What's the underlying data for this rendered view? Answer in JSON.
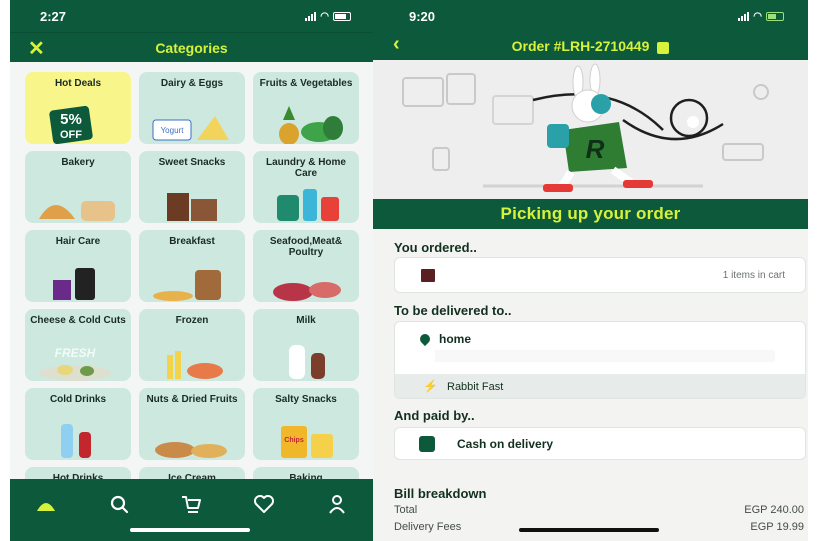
{
  "left": {
    "status_time": "2:27",
    "title": "Categories",
    "categories": [
      "Hot Deals",
      "Dairy & Eggs",
      "Fruits & Vegetables",
      "Bakery",
      "Sweet Snacks",
      "Laundry & Home Care",
      "Hair Care",
      "Breakfast",
      "Seafood,Meat& Poultry",
      "Cheese & Cold Cuts",
      "Frozen",
      "Milk",
      "Cold Drinks",
      "Nuts & Dried Fruits",
      "Salty Snacks",
      "Hot Drinks",
      "Ice Cream",
      "Baking"
    ],
    "hot_badge_pct": "5%",
    "hot_badge_off": "OFF",
    "yogurt_label": "Yogurt",
    "fresh_label": "FRESH",
    "chips_label": "Chips",
    "tabs": [
      "home-icon",
      "search-icon",
      "cart-icon",
      "heart-icon",
      "profile-icon"
    ],
    "accent": "#d7f23a",
    "brand": "#0c5a3b"
  },
  "right": {
    "status_time": "9:20",
    "order_title": "Order #LRH-2710449",
    "banner": "Picking up your order",
    "ordered_heading": "You ordered..",
    "items_count": "1 items in cart",
    "delivered_heading": "To be delivered to..",
    "address_label": "home",
    "delivery_method": "Rabbit Fast",
    "paid_heading": "And paid by..",
    "payment_method": "Cash on delivery",
    "bill_heading": "Bill breakdown",
    "bill": [
      {
        "label": "Total",
        "value": "EGP 240.00"
      },
      {
        "label": "Delivery Fees",
        "value": "EGP 19.99"
      }
    ]
  }
}
